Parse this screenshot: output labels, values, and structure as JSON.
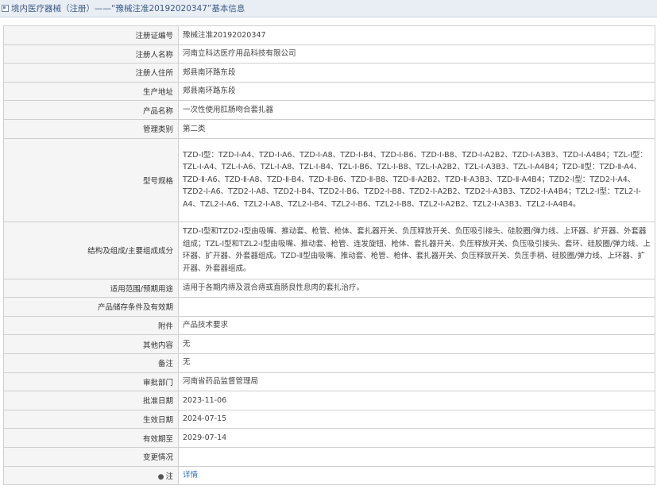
{
  "header": {
    "title": "境内医疗器械（注册）——“豫械注准20192020347”基本信息"
  },
  "rows": [
    {
      "label": "注册证编号",
      "value": "豫械注准20192020347"
    },
    {
      "label": "注册人名称",
      "value": "河南立科达医疗用品科技有限公司"
    },
    {
      "label": "注册人住所",
      "value": "郏县南环路东段"
    },
    {
      "label": "生产地址",
      "value": "郏县南环路东段"
    },
    {
      "label": "产品名称",
      "value": "一次性使用肛肠吻合套扎器"
    },
    {
      "label": "管理类别",
      "value": "第二类"
    },
    {
      "label": "型号规格",
      "value": "TZD-Ⅰ型：TZD-Ⅰ-A4、TZD-Ⅰ-A6、TZD-Ⅰ-A8、TZD-Ⅰ-B4、TZD-Ⅰ-B6、TZD-Ⅰ-B8、TZD-Ⅰ-A2B2、TZD-Ⅰ-A3B3、TZD-Ⅰ-A4B4；TZL-Ⅰ型：TZL-Ⅰ-A4、TZL-Ⅰ-A6、TZL-Ⅰ-A8、TZL-Ⅰ-B4、TZL-Ⅰ-B6、TZL-Ⅰ-B8、TZL-Ⅰ-A2B2、TZL-Ⅰ-A3B3、TZL-Ⅰ-A4B4；TZD-Ⅱ型：TZD-Ⅱ-A4、TZD-Ⅱ-A6、TZD-Ⅱ-A8、TZD-Ⅱ-B4、TZD-Ⅱ-B6、TZD-Ⅱ-B8、TZD-Ⅱ-A2B2、TZD-Ⅱ-A3B3、TZD-Ⅱ-A4B4；TZD2-Ⅰ型：TZD2-Ⅰ-A4、TZD2-Ⅰ-A6、TZD2-Ⅰ-A8、TZD2-Ⅰ-B4、TZD2-Ⅰ-B6、TZD2-Ⅰ-B8、TZD2-Ⅰ-A2B2、TZD2-Ⅰ-A3B3、TZD2-Ⅰ-A4B4；TZL2-Ⅰ型：TZL2-Ⅰ-A4、TZL2-Ⅰ-A6、TZL2-Ⅰ-A8、TZL2-Ⅰ-B4、TZL2-Ⅰ-B6、TZL2-Ⅰ-B8、TZL2-Ⅰ-A2B2、TZL2-Ⅰ-A3B3、TZL2-Ⅰ-A4B4。"
    },
    {
      "label": "结构及组成/主要组成成分",
      "value": "TZD-Ⅰ型和TZD2-Ⅰ型由吸嘴、推动套、枪管、枪体、套扎器开关、负压释放开关、负压吸引接头、硅胶圈/弹力线、上环器、扩开器、外套器组成；TZL-Ⅰ型和TZL2-Ⅰ型由吸嘴、推动套、枪管、连发旋钮、枪体、套扎器开关、负压释放开关、负压吸引接头、套环、硅胶圈/弹力线、上环器、扩开器、外套器组成。TZD-Ⅱ型由吸嘴、推动套、枪管、枪体、套扎器开关、负压释放开关、负压手柄、硅胶圈/弹力线、上环器、扩开器、外套器组成。"
    },
    {
      "label": "适用范围/预期用途",
      "value": "适用于各期内痔及混合痔或直肠良性息肉的套扎治疗。"
    },
    {
      "label": "产品储存条件及有效期",
      "value": ""
    },
    {
      "label": "附件",
      "value": "产品技术要求"
    },
    {
      "label": "其他内容",
      "value": "无"
    },
    {
      "label": "备注",
      "value": "无"
    },
    {
      "label": "审批部门",
      "value": "河南省药品监督管理局"
    },
    {
      "label": "批准日期",
      "value": "2023-11-06"
    },
    {
      "label": "生效日期",
      "value": "2024-07-15"
    },
    {
      "label": "有效期至",
      "value": "2029-07-14"
    },
    {
      "label": "变更情况",
      "value": ""
    },
    {
      "label": "注",
      "value": "详情"
    }
  ]
}
